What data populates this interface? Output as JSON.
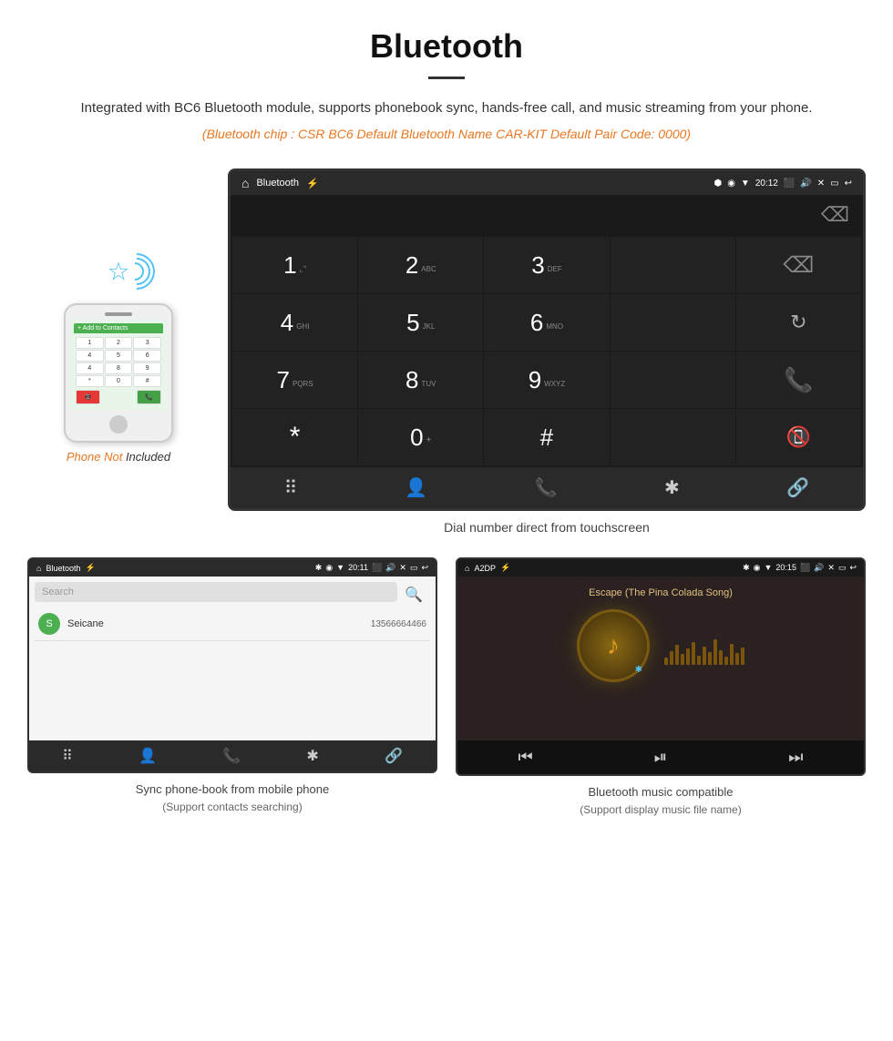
{
  "header": {
    "title": "Bluetooth",
    "description": "Integrated with BC6 Bluetooth module, supports phonebook sync, hands-free call, and music streaming from your phone.",
    "specs": "(Bluetooth chip : CSR BC6    Default Bluetooth Name CAR-KIT    Default Pair Code: 0000)"
  },
  "phone_label": {
    "not": "Phone Not",
    "included": " Included"
  },
  "car_screen": {
    "statusbar": {
      "title": "Bluetooth",
      "time": "20:12"
    },
    "dialpad": {
      "keys": [
        {
          "num": "1",
          "sub": ""
        },
        {
          "num": "2",
          "sub": "ABC"
        },
        {
          "num": "3",
          "sub": "DEF"
        },
        {
          "num": "4",
          "sub": "GHI"
        },
        {
          "num": "5",
          "sub": "JKL"
        },
        {
          "num": "6",
          "sub": "MNO"
        },
        {
          "num": "7",
          "sub": "PQRS"
        },
        {
          "num": "8",
          "sub": "TUV"
        },
        {
          "num": "9",
          "sub": "WXYZ"
        },
        {
          "num": "*",
          "sub": ""
        },
        {
          "num": "0",
          "sub": "+"
        },
        {
          "num": "#",
          "sub": ""
        }
      ]
    },
    "caption": "Dial number direct from touchscreen"
  },
  "phonebook_screen": {
    "statusbar": {
      "title": "Bluetooth",
      "time": "20:11"
    },
    "search_placeholder": "Search",
    "contacts": [
      {
        "initial": "S",
        "name": "Seicane",
        "number": "13566664466"
      }
    ],
    "caption": "Sync phone-book from mobile phone",
    "caption_sub": "(Support contacts searching)"
  },
  "music_screen": {
    "statusbar": {
      "title": "A2DP",
      "time": "20:15"
    },
    "song_title": "Escape (The Pina Colada Song)",
    "caption": "Bluetooth music compatible",
    "caption_sub": "(Support display music file name)"
  }
}
